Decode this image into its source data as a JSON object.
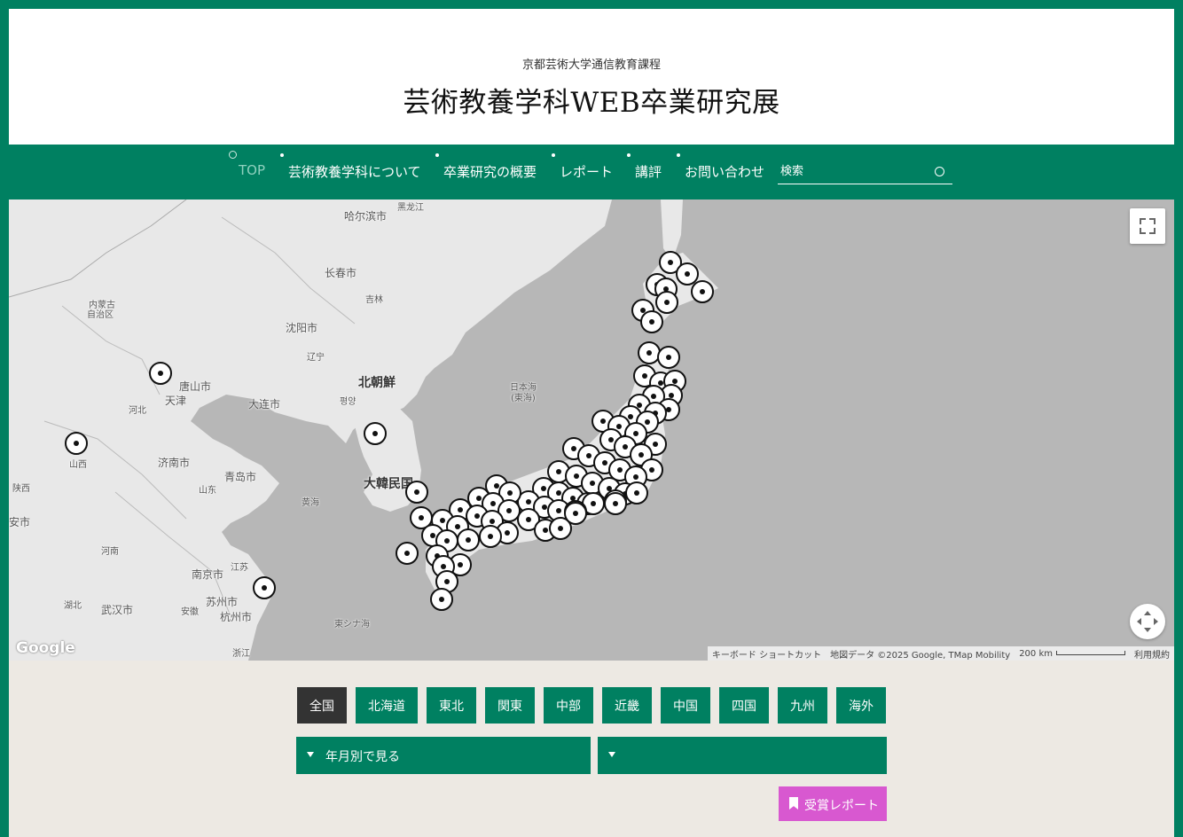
{
  "header": {
    "subtitle": "京都芸術大学通信教育課程",
    "title": "芸術教養学科WEB卒業研究展"
  },
  "nav": {
    "items": [
      {
        "label": "TOP",
        "active": true
      },
      {
        "label": "芸術教養学科について"
      },
      {
        "label": "卒業研究の概要"
      },
      {
        "label": "レポート"
      },
      {
        "label": "講評"
      },
      {
        "label": "お問い合わせ"
      }
    ],
    "search_placeholder": "検索"
  },
  "map": {
    "labels": {
      "harbin": "哈尔滨市",
      "heilongjiang": "黑龙江",
      "changchun": "长春市",
      "jilin": "吉林",
      "shenyang": "沈阳市",
      "liaoning": "辽宁",
      "inner_mongolia_1": "内蒙古",
      "inner_mongolia_2": "自治区",
      "tangshan": "唐山市",
      "tianjin": "天津",
      "hebei": "河北",
      "dalian": "大连市",
      "north_korea": "北朝鮮",
      "pyongyang": "평양",
      "sea_of_japan_1": "日本海",
      "sea_of_japan_2": "(東海)",
      "shanxi": "山西",
      "jinan": "济南市",
      "shandong": "山东",
      "qingdao": "青岛市",
      "south_korea": "大韓民国",
      "shaanxi": "陕西",
      "xian": "安市",
      "yellow_sea": "黄海",
      "henan": "河南",
      "nanjing": "南京市",
      "jiangsu": "江苏",
      "hubei": "湖北",
      "wuhan": "武汉市",
      "anhui": "安徽",
      "suzhou": "苏州市",
      "hangzhou": "杭州市",
      "east_china_sea": "東シナ海",
      "zhejiang": "浙江"
    },
    "google_logo": "Google",
    "attribution": {
      "shortcuts": "キーボード ショートカット",
      "data": "地図データ ©2025 Google, TMap Mobility",
      "scale": "200 km",
      "terms": "利用規約"
    }
  },
  "filters": {
    "regions": [
      "全国",
      "北海道",
      "東北",
      "関東",
      "中部",
      "近畿",
      "中国",
      "四国",
      "九州",
      "海外"
    ],
    "active_region": "全国",
    "year_month_select": "年月別で見る",
    "second_select": "",
    "award_button": "受賞レポート"
  },
  "colors": {
    "brand_green": "#008061",
    "active_region_bg": "#333333",
    "award_pink": "#d858d0",
    "content_bg": "#ede9e3"
  }
}
